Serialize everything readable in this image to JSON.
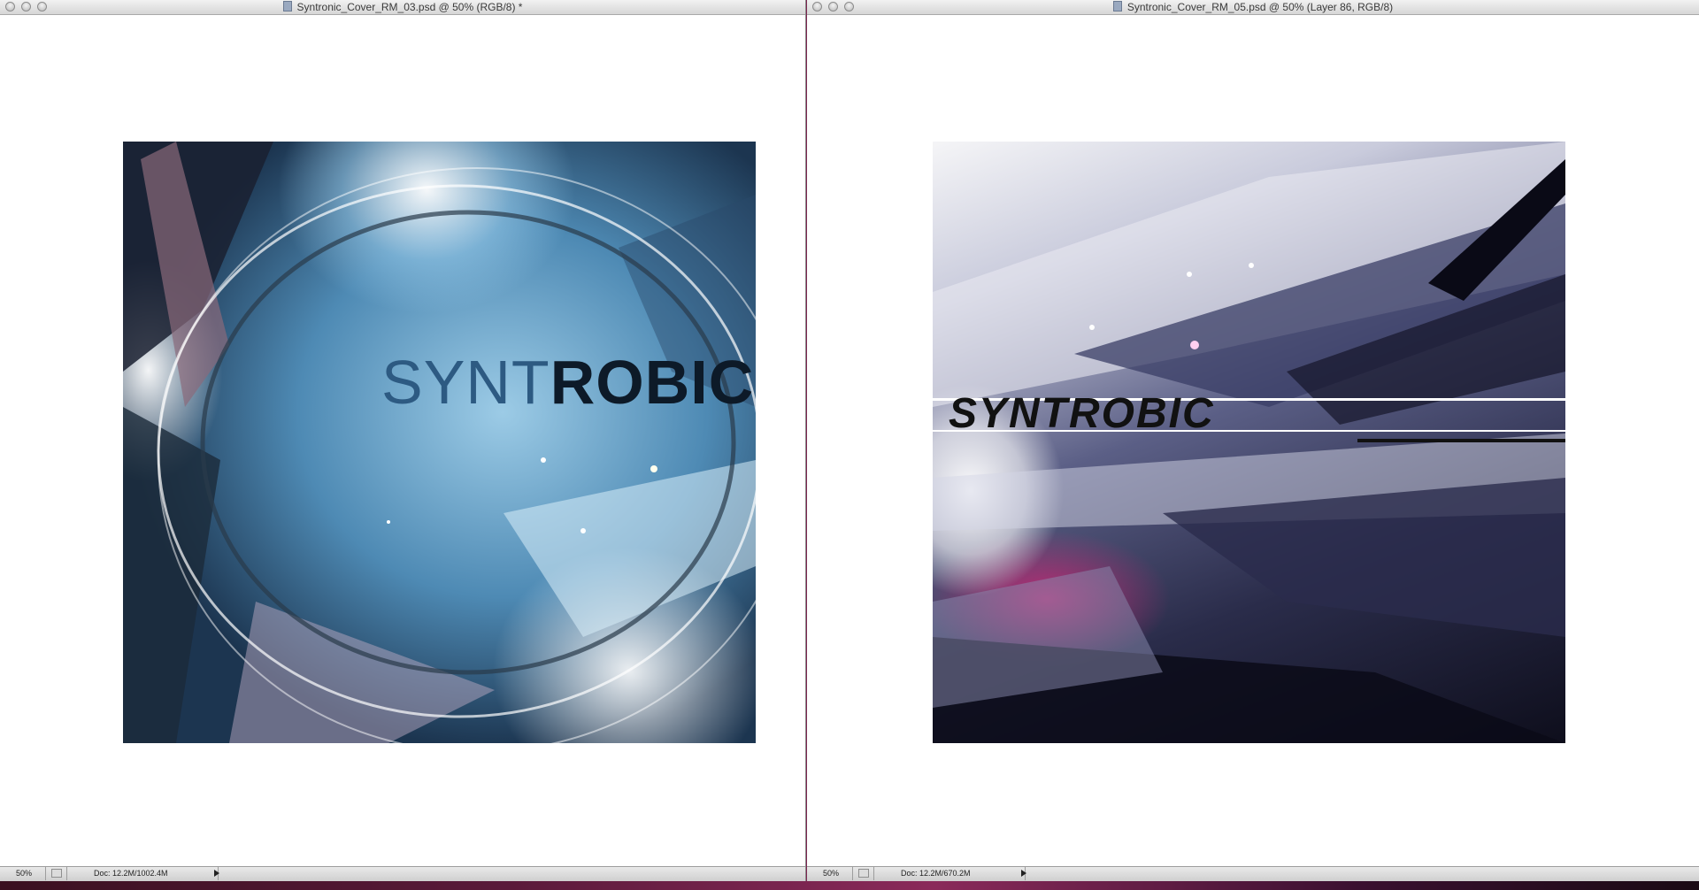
{
  "windows": [
    {
      "title": "Syntronic_Cover_RM_03.psd @ 50% (RGB/8) *",
      "zoom": "50%",
      "doc_info": "Doc: 12.2M/1002.4M",
      "artwork_text_light": "SYNT",
      "artwork_text_bold": "ROBIC"
    },
    {
      "title": "Syntronic_Cover_RM_05.psd @ 50% (Layer 86, RGB/8)",
      "zoom": "50%",
      "doc_info": "Doc: 12.2M/670.2M",
      "artwork_text": "SYNTROBIC"
    }
  ],
  "icons": {
    "close": "close-button-icon",
    "minimize": "minimize-button-icon",
    "zoom": "zoom-button-icon",
    "document": "psd-document-icon",
    "status_menu": "status-menu-arrow-icon"
  },
  "colors": {
    "window_bg": "#ffffff",
    "titlebar": "#d6d6d6",
    "statusbar": "#cfcfcf",
    "desktop": "#5a1a3a"
  }
}
